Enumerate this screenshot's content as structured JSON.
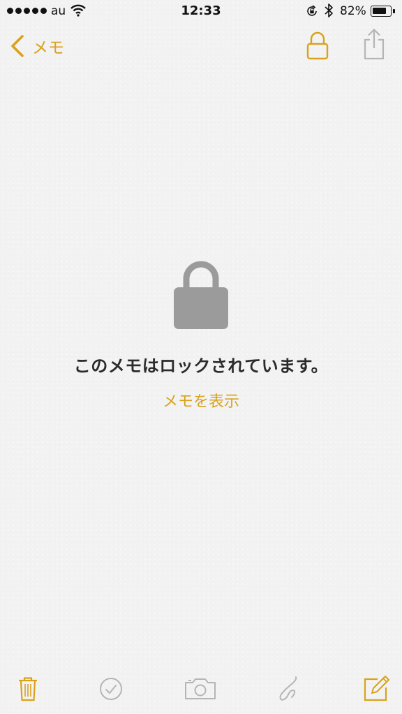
{
  "status_bar": {
    "carrier": "au",
    "time": "12:33",
    "battery_percent": "82%",
    "battery_level": 0.82,
    "icons": [
      "signal-dots-icon",
      "wifi-icon",
      "rotation-lock-icon",
      "bluetooth-icon",
      "battery-icon"
    ]
  },
  "nav": {
    "back_label": "メモ",
    "icons": [
      "chevron-left-icon",
      "lock-icon",
      "share-icon"
    ]
  },
  "content": {
    "locked_message": "このメモはロックされています。",
    "show_note_label": "メモを表示",
    "icon": "large-lock-icon"
  },
  "toolbar": {
    "icons": [
      "trash-icon",
      "checklist-icon",
      "camera-icon",
      "sketch-icon",
      "compose-icon"
    ]
  },
  "colors": {
    "accent": "#d9a21b",
    "disabled": "#b5b5b5",
    "lock_gray": "#9b9b9b",
    "background": "#f2f2f2",
    "text": "#2b2b2b"
  }
}
